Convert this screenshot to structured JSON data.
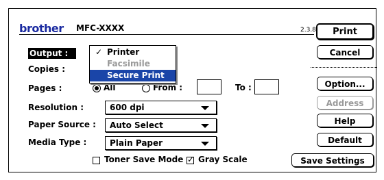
{
  "header": {
    "brand": "brother",
    "model": "MFC-XXXX",
    "version": "2.3.8"
  },
  "labels": {
    "output": "Output :",
    "copies": "Copies :",
    "pages": "Pages :",
    "resolution": "Resolution :",
    "paper_source": "Paper Source :",
    "media_type": "Media Type :"
  },
  "output_menu": {
    "items": [
      {
        "label": "Printer",
        "checked": true,
        "enabled": true
      },
      {
        "label": "Facsimile",
        "checked": false,
        "enabled": false
      },
      {
        "label": "Secure Print",
        "checked": false,
        "highlighted": true
      }
    ]
  },
  "pages": {
    "all_label": "All",
    "from_label": "From :",
    "to_label": "To :",
    "selected": "All",
    "from_value": "",
    "to_value": ""
  },
  "selects": {
    "resolution": "600 dpi",
    "paper_source": "Auto Select",
    "media_type": "Plain Paper"
  },
  "checkboxes": {
    "toner_save_label": "Toner Save Mode",
    "toner_save_checked": false,
    "gray_scale_label": "Gray Scale",
    "gray_scale_checked": true
  },
  "buttons": {
    "print": "Print",
    "cancel": "Cancel",
    "option": "Option...",
    "address": "Address",
    "help": "Help",
    "default": "Default",
    "save_settings": "Save Settings"
  },
  "icons": {
    "check": "check-icon",
    "dropdown_arrow": "triangle-down-icon"
  }
}
